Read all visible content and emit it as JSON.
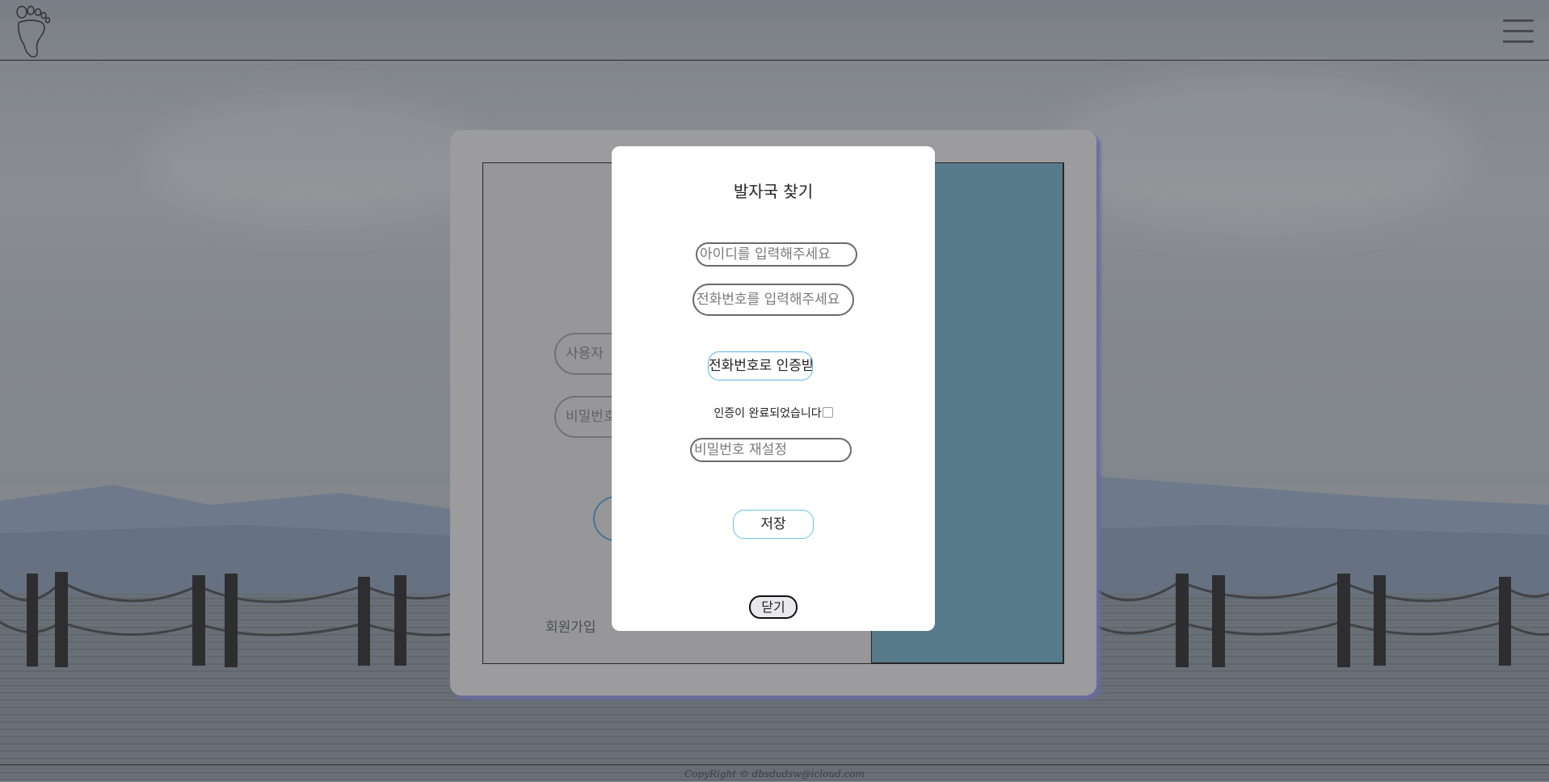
{
  "header": {
    "logo_icon": "footprint-icon",
    "menu_icon": "hamburger-menu-icon"
  },
  "login_card": {
    "username_placeholder": "사용자",
    "password_placeholder": "비밀번호",
    "signup_link": "회원가입",
    "panel_color": "#4e7a8f"
  },
  "modal": {
    "title": "발자국 찾기",
    "id_placeholder": "아이디를 입력해주세요",
    "phone_placeholder": "전화번호를 입력해주세요",
    "verify_button": "전화번호로 인증받기",
    "verify_status": "인증이 완료되었습니다",
    "verify_checked": false,
    "new_password_placeholder": "비밀번호 재설정",
    "save_button": "저장",
    "close_button": "닫기"
  },
  "footer": {
    "copyright": "CopyRight © dbsdudsw@icloud.com"
  },
  "colors": {
    "accent_border": "#5fb5e6",
    "card_shadow": "#6467a8"
  }
}
